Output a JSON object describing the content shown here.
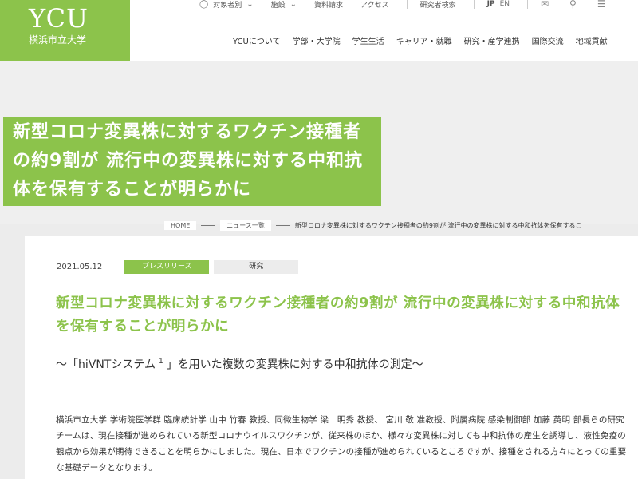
{
  "brand": {
    "logo_main": "YCU",
    "logo_sub": "横浜市立大学"
  },
  "utility_nav": {
    "target": "対象者別",
    "facilities": "施設",
    "request": "資料請求",
    "access": "アクセス",
    "researcher": "研究者検索",
    "lang_jp": "JP",
    "lang_en": "EN",
    "icons": [
      "person-icon",
      "chevron-icon",
      "mail-icon",
      "search-icon",
      "menu-icon"
    ]
  },
  "global_nav": [
    "YCUについて",
    "学部・大学院",
    "学生生活",
    "キャリア・就職",
    "研究・産学連携",
    "国際交流",
    "地域貢献"
  ],
  "hero": {
    "title": "新型コロナ変異株に対するワクチン接種者の約9割が 流行中の変異株に対する中和抗体を保有することが明らかに"
  },
  "breadcrumb": {
    "home": "HOME",
    "list": "ニュース一覧",
    "current": "新型コロナ変異株に対するワクチン接種者の約9割が 流行中の変異株に対する中和抗体を保有するこ"
  },
  "article": {
    "date": "2021.05.12",
    "tags": [
      "プレスリリース",
      "研究"
    ],
    "title": "新型コロナ変異株に対するワクチン接種者の約9割が 流行中の変異株に対する中和抗体を保有することが明らかに",
    "subtitle_pre": "～「hiVNTシステム",
    "subtitle_sup": "1",
    "subtitle_post": "」を用いた複数の変異株に対する中和抗体の測定～",
    "body": "横浜市立大学 学術院医学群 臨床統計学 山中 竹春 教授、同微生物学 梁　明秀 教授、 宮川 敬 准教授、附属病院 感染制御部 加藤 英明 部長らの研究チームは、現在接種が進められている新型コロナウイルスワクチンが、従来株のほか、様々な変異株に対しても中和抗体の産生を誘導し、液性免疫の観点から効果が期待できることを明らかにしました。現在、日本でワクチンの接種が進められているところですが、接種をされる方々にとっての重要な基礎データとなります。"
  },
  "colors": {
    "accent": "#8cc34b",
    "background": "#ececec"
  }
}
